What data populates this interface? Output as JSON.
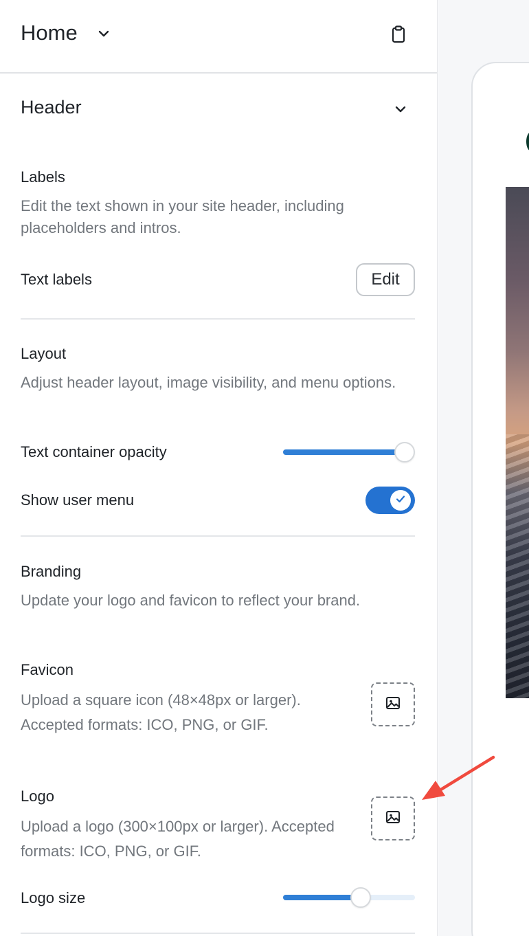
{
  "topbar": {
    "title": "Home"
  },
  "section": {
    "title": "Header"
  },
  "labels": {
    "title": "Labels",
    "description": "Edit the text shown in your site header, including placeholders and intros.",
    "row_label": "Text labels",
    "edit_label": "Edit"
  },
  "layout": {
    "title": "Layout",
    "description": "Adjust header layout, image visibility, and menu options.",
    "opacity_label": "Text container opacity",
    "opacity_value": 1.0,
    "user_menu_label": "Show user menu",
    "user_menu_on": true
  },
  "branding": {
    "title": "Branding",
    "description": "Update your logo and favicon to reflect your brand.",
    "favicon_title": "Favicon",
    "favicon_desc": "Upload a square icon (48×48px or larger). Accepted formats: ICO, PNG, or GIF.",
    "logo_title": "Logo",
    "logo_desc": "Upload a logo (300×100px or larger). Accepted formats: ICO, PNG, or GIF.",
    "logo_size_label": "Logo size",
    "logo_size_value": 0.59
  },
  "colors": {
    "accent": "#2472d1",
    "slider": "#2f7fd6",
    "annotation": "#f04a3e"
  },
  "icons": {
    "title_chevron": "chevron-down-icon",
    "clipboard": "clipboard-icon",
    "section_chevron": "chevron-down-icon",
    "image": "image-icon",
    "check": "check-icon",
    "arrow": "annotation-arrow-icon"
  }
}
